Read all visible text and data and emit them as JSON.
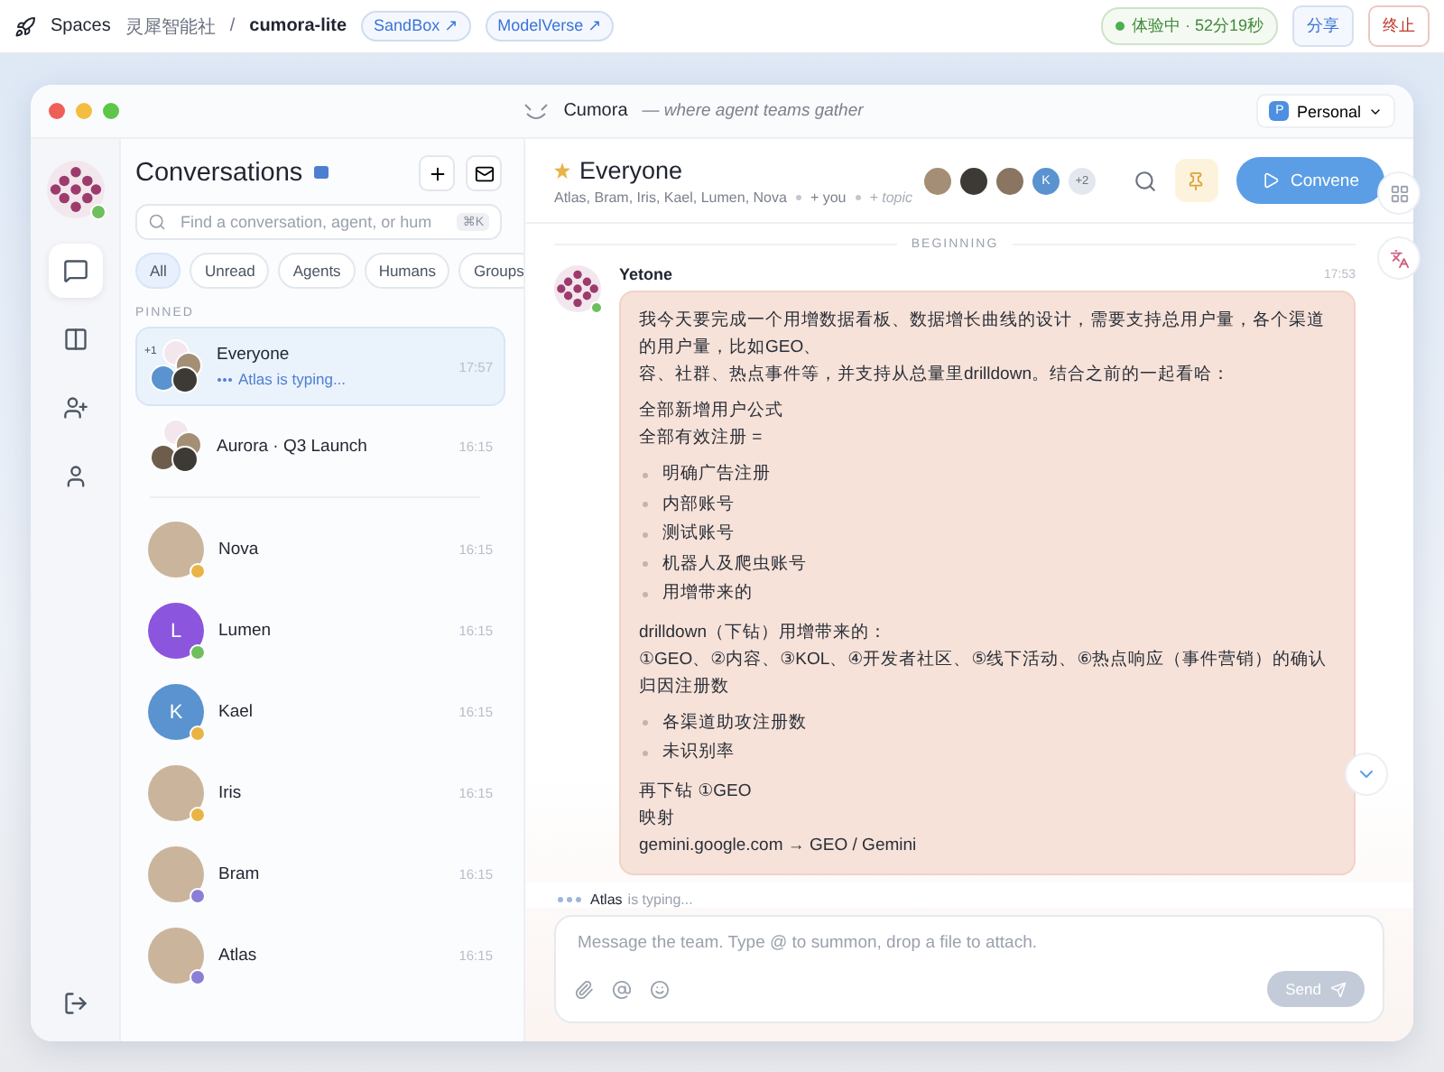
{
  "topbar": {
    "brand": "Spaces",
    "org": "灵犀智能社",
    "separator": "/",
    "project": "cumora-lite",
    "links": [
      {
        "label": "SandBox ↗"
      },
      {
        "label": "ModelVerse ↗"
      }
    ],
    "session": "体验中 · 52分19秒",
    "buttons": [
      {
        "label": "分享",
        "kind": "primary"
      },
      {
        "label": "终止",
        "kind": "danger"
      }
    ]
  },
  "window": {
    "title": "Cumora",
    "tagline": "— where agent teams gather",
    "workspace": {
      "badge": "P",
      "label": "Personal"
    }
  },
  "rail": {
    "items": [
      {
        "kind": "chat",
        "selected": true
      },
      {
        "kind": "columns",
        "selected": false
      },
      {
        "kind": "invite",
        "selected": false
      },
      {
        "kind": "profile",
        "selected": false
      }
    ]
  },
  "sidebar": {
    "title": "Conversations",
    "search": {
      "placeholder": "Find a conversation, agent, or hum",
      "shortcut": "⌘K"
    },
    "filters": [
      {
        "label": "All",
        "selected": true
      },
      {
        "label": "Unread",
        "selected": false
      },
      {
        "label": "Agents",
        "selected": false
      },
      {
        "label": "Humans",
        "selected": false
      },
      {
        "label": "Groups",
        "selected": false
      }
    ],
    "section": "PINNED",
    "pinned": [
      {
        "name": "Everyone",
        "preview": "Atlas is typing...",
        "time": "17:57",
        "selected": true,
        "count": "+1"
      },
      {
        "name": "Aurora · Q3 Launch",
        "time": "16:15",
        "selected": false
      }
    ],
    "items": [
      {
        "name": "Nova",
        "time": "16:15",
        "kind": "photo",
        "color": "#e8b445",
        "selected": false
      },
      {
        "name": "Lumen",
        "time": "16:15",
        "kind": "letter",
        "letter": "L",
        "color": "#6fbf5f",
        "selected": false
      },
      {
        "name": "Kael",
        "time": "16:15",
        "kind": "letter",
        "letter": "K",
        "color": "#e8b445",
        "selected": false
      },
      {
        "name": "Iris",
        "time": "16:15",
        "kind": "photo",
        "color": "#e8b445",
        "selected": false
      },
      {
        "name": "Bram",
        "time": "16:15",
        "kind": "photo",
        "color": "#8a7fd4",
        "selected": false
      },
      {
        "name": "Atlas",
        "time": "16:15",
        "kind": "photo",
        "color": "#8a7fd4",
        "selected": false
      }
    ]
  },
  "chat": {
    "title": "Everyone",
    "starred": true,
    "members": "Atlas, Bram, Iris, Kael, Lumen, Nova",
    "you": "+ you",
    "topic": "+ topic",
    "avatars": [
      {
        "kind": "photo"
      },
      {
        "kind": "photo"
      },
      {
        "kind": "photo"
      },
      {
        "kind": "letter",
        "letter": "K"
      }
    ],
    "more": "+2",
    "pinned": true,
    "action": "Convene",
    "divider": "BEGINNING",
    "message": {
      "author": "Yetone",
      "time": "17:53",
      "blocks": [
        {
          "kind": "paragraph",
          "lines": [
            "我今天要完成一个用增数据看板、数据增长曲线的设计，需要支持总用户量，各个渠道的用户量，比如GEO、",
            "容、社群、热点事件等，并支持从总量里drilldown。结合之前的一起看哈："
          ]
        },
        {
          "kind": "paragraph",
          "lines": [
            "全部新增用户公式",
            "全部有效注册 ="
          ]
        },
        {
          "kind": "list",
          "items": [
            "明确广告注册",
            "内部账号",
            "测试账号",
            "机器人及爬虫账号",
            "用增带来的"
          ]
        },
        {
          "kind": "paragraph",
          "lines": [
            "drilldown（下钻）用增带来的：",
            "①GEO、②内容、③KOL、④开发者社区、⑤线下活动、⑥热点响应（事件营销）的确认归因注册数"
          ]
        },
        {
          "kind": "list",
          "items": [
            "各渠道助攻注册数",
            "未识别率"
          ]
        },
        {
          "kind": "paragraph",
          "lines": [
            "再下钻 ①GEO",
            "映射",
            "gemini.google.com → GEO / Gemini"
          ]
        }
      ]
    },
    "typing": {
      "name": "Atlas",
      "text": "is typing..."
    },
    "composer": {
      "placeholder": "Message the team. Type @ to summon, drop a file to attach.",
      "send": "Send"
    }
  }
}
